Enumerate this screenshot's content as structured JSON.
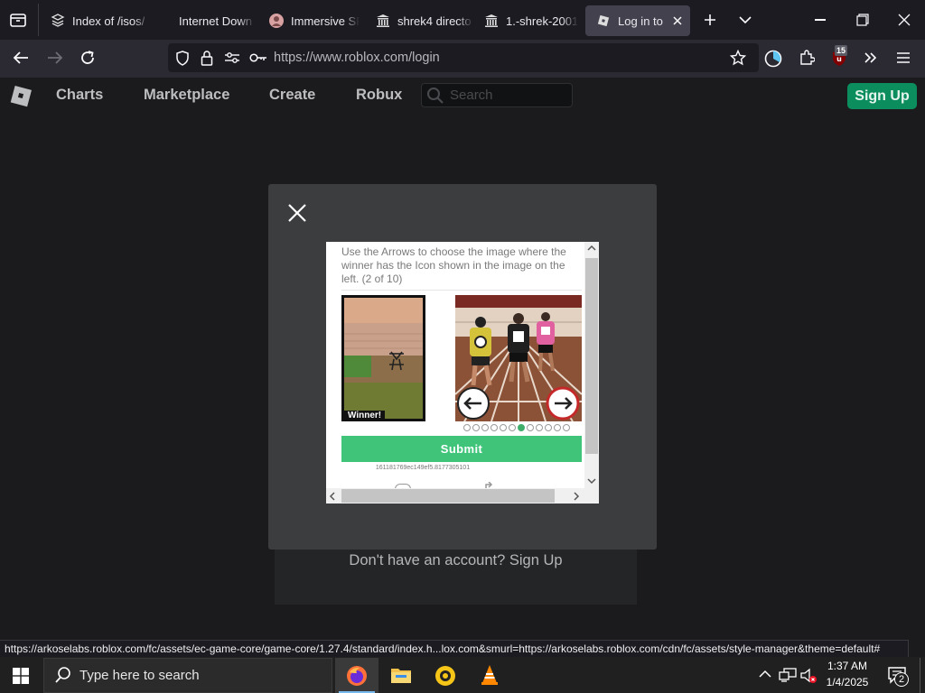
{
  "browser": {
    "tabs": [
      {
        "label": "Index of /isos/",
        "icon": "archive-icon"
      },
      {
        "label": "Internet Down",
        "icon": "none"
      },
      {
        "label": "Immersive SF",
        "icon": "avatar-icon"
      },
      {
        "label": "shrek4 directo",
        "icon": "archive-building-icon"
      },
      {
        "label": "1.-shrek-2001",
        "icon": "archive-building-icon"
      },
      {
        "label": "Log in to R",
        "icon": "roblox-icon"
      }
    ],
    "url": "https://www.roblox.com/login",
    "extension_badge": "15"
  },
  "roblox": {
    "nav": [
      "Charts",
      "Marketplace",
      "Create",
      "Robux"
    ],
    "search_placeholder": "Search",
    "signup_button": "Sign Up",
    "no_account_text": "Don't have an account? Sign Up"
  },
  "captcha": {
    "instructions": "Use the Arrows to choose the image where the winner has the Icon shown in the image on the left. (2 of 10)",
    "winner_label": "Winner!",
    "submit_label": "Submit",
    "session_id": "161181769ec149ef5.8177305101",
    "dots_total": 12,
    "dots_active_index": 6
  },
  "status_link": "https://arkoselabs.roblox.com/fc/assets/ec-game-core/game-core/1.27.4/standard/index.h...lox.com&smurl=https://arkoselabs.roblox.com/cdn/fc/assets/style-manager&theme=default#",
  "taskbar": {
    "search_placeholder": "Type here to search",
    "time": "1:37 AM",
    "date": "1/4/2025",
    "notification_count": "2"
  }
}
